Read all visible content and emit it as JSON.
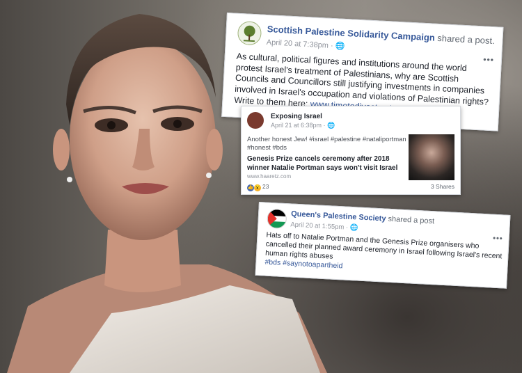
{
  "post1": {
    "page_name": "Scottish Palestine Solidarity Campaign",
    "shared_text": "shared a post.",
    "timestamp": "April 20 at 7:38pm",
    "more": "•••",
    "body": "As cultural, political figures and institutions around the world protest Israel's treatment of Palestinians, why are Scottish Councils and Councillors still justifying investments in companies involved in Israel's occupation and violations of Palestinian rights? Write to them here: ",
    "link": "www.timetodivest.net"
  },
  "post2": {
    "page_name": "Exposing Israel",
    "timestamp": "April 21 at 6:38pm",
    "tags": "Another honest Jew! #israel #palestine #nataliportman #honest #bds",
    "headline": "Genesis Prize cancels ceremony after 2018 winner Natalie Portman says won't visit Israel",
    "domain": "www.haaretz.com",
    "reaction_count": "23",
    "shares": "3 Shares"
  },
  "post3": {
    "page_name": "Queen's Palestine Society",
    "shared_text": "shared a post",
    "timestamp": "April 20 at 1:55pm",
    "more": "•••",
    "body": "Hats off to Natalie Portman and the Genesis Prize organisers who cancelled their planned award ceremony in Israel following Israel's recent human rights abuses",
    "hashtags": "#bds #saynotoapartheid"
  }
}
